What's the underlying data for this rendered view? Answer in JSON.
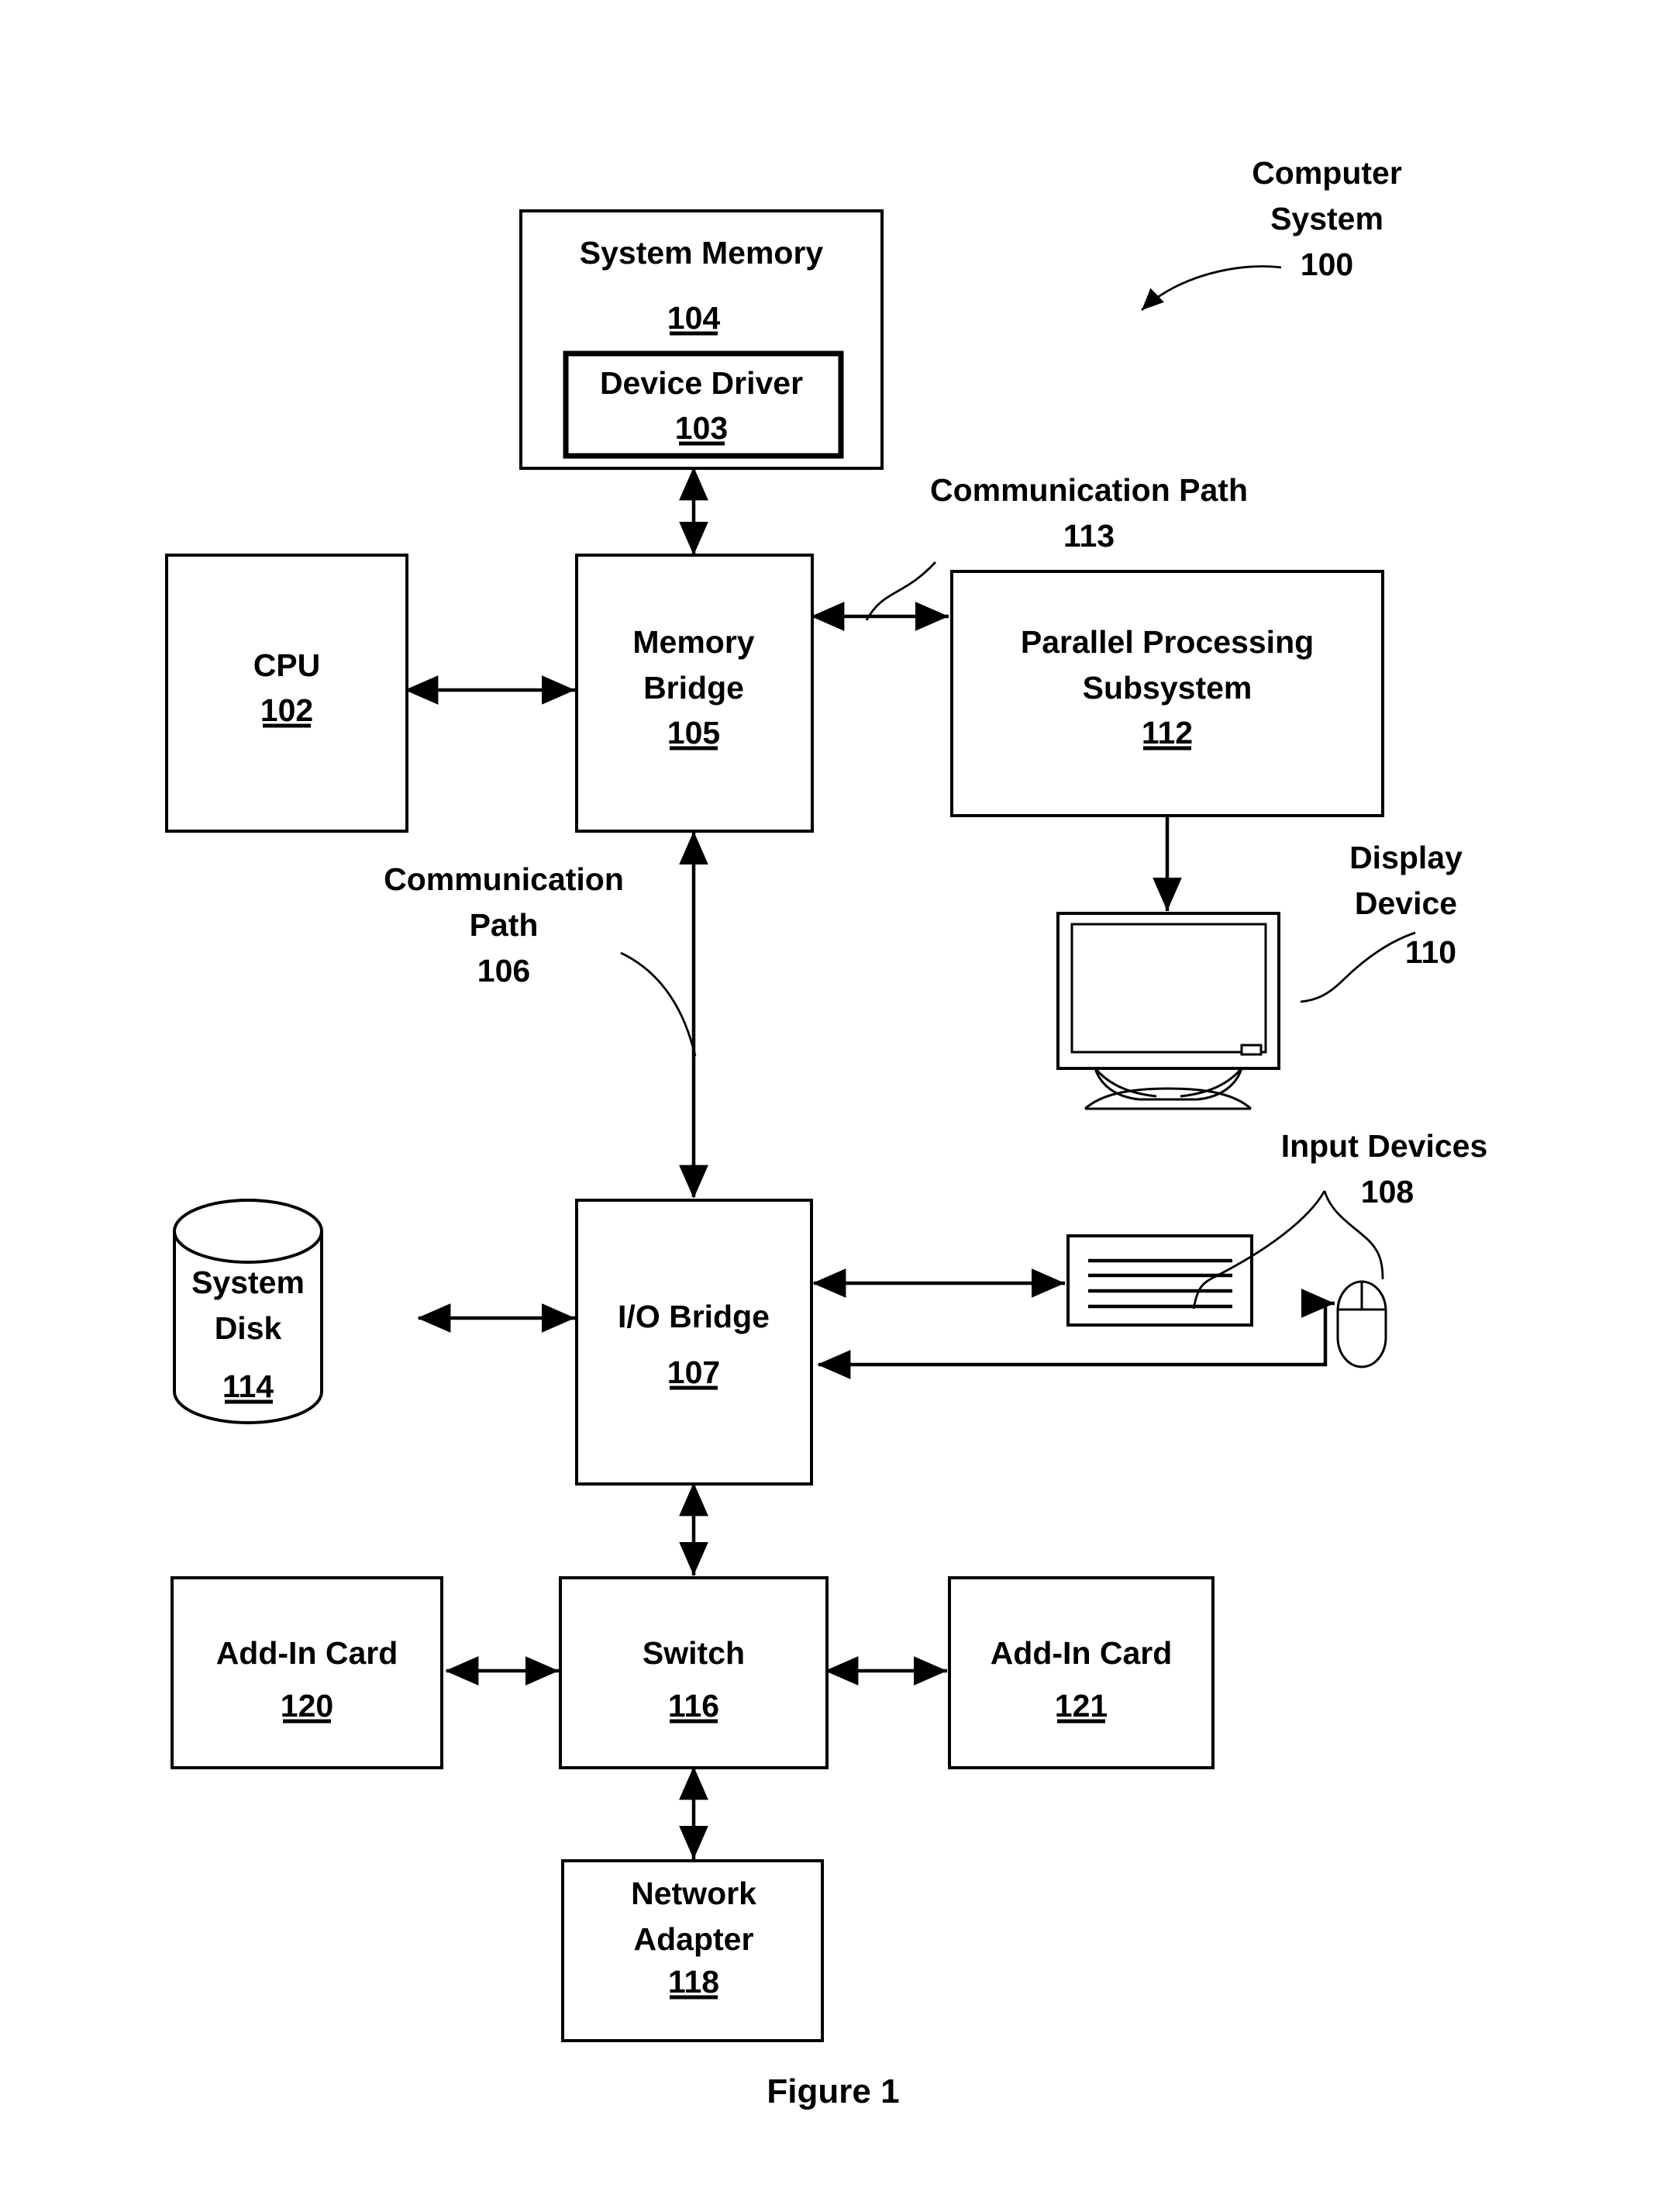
{
  "figure": {
    "caption": "Figure 1",
    "title_callout": {
      "line1": "Computer",
      "line2": "System",
      "number": "100"
    }
  },
  "blocks": {
    "system_memory": {
      "label": "System Memory",
      "number": "104"
    },
    "device_driver": {
      "label": "Device Driver",
      "number": "103"
    },
    "cpu": {
      "label": "CPU",
      "number": "102"
    },
    "memory_bridge": {
      "label_line1": "Memory",
      "label_line2": "Bridge",
      "number": "105"
    },
    "parallel_processing_subsystem": {
      "label_line1": "Parallel Processing",
      "label_line2": "Subsystem",
      "number": "112"
    },
    "io_bridge": {
      "label": "I/O Bridge",
      "number": "107"
    },
    "system_disk": {
      "label_line1": "System",
      "label_line2": "Disk",
      "number": "114"
    },
    "switch": {
      "label": "Switch",
      "number": "116"
    },
    "add_in_card_left": {
      "label": "Add-In Card",
      "number": "120"
    },
    "add_in_card_right": {
      "label": "Add-In Card",
      "number": "121"
    },
    "network_adapter": {
      "label_line1": "Network",
      "label_line2": "Adapter",
      "number": "118"
    }
  },
  "callouts": {
    "communication_path_113": {
      "line1": "Communication Path",
      "number": "113"
    },
    "communication_path_106": {
      "line1": "Communication",
      "line2": "Path",
      "number": "106"
    },
    "display_device": {
      "line1": "Display",
      "line2": "Device",
      "number": "110"
    },
    "input_devices": {
      "line1": "Input Devices",
      "number": "108"
    }
  },
  "icons": {
    "display_device": "monitor-icon",
    "system_disk": "cylinder-database-icon",
    "keyboard": "keyboard-icon",
    "mouse": "mouse-icon"
  },
  "colors": {
    "ink": "#000000",
    "paper": "#ffffff"
  }
}
